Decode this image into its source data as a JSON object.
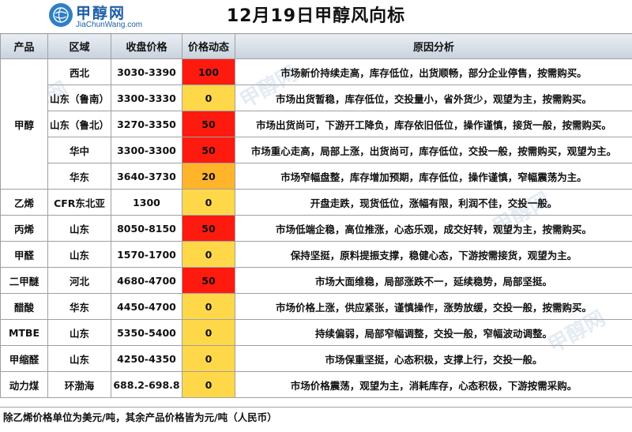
{
  "header": {
    "logo_brand": "甲醇网",
    "logo_url": "JiaChunWang.com",
    "title": "12月19日甲醇风向标"
  },
  "table": {
    "columns": [
      "产品",
      "区域",
      "收盘价格",
      "价格动态",
      "原因分析"
    ],
    "groups": [
      {
        "product": "甲醇",
        "rows": [
          {
            "region": "西北",
            "price": "3030-3390",
            "dynamic": "100",
            "level": "red",
            "reason": "市场新价持续走高，库存低位，出货顺畅，部分企业停售，按需购买。"
          },
          {
            "region": "山东（鲁南）",
            "price": "3300-3330",
            "dynamic": "0",
            "level": "yellow",
            "reason": "市场出货暂稳，库存低位，交投量小，省外货少，观望为主，按需购买。"
          },
          {
            "region": "山东（鲁北）",
            "price": "3270-3350",
            "dynamic": "50",
            "level": "red",
            "reason": "市场出货尚可，下游开工降负，库存依旧低位，操作谨慎，接货一般，按需购买。"
          },
          {
            "region": "华中",
            "price": "3300-3300",
            "dynamic": "50",
            "level": "red",
            "reason": "市场重心走高，局部上涨，出货尚可，库存低位，交投一般，按需购买，观望为主。"
          },
          {
            "region": "华东",
            "price": "3640-3730",
            "dynamic": "20",
            "level": "orange",
            "reason": "市场窄幅盘整，库存增加预期，库存低位，操作谨慎，窄幅震荡为主。"
          }
        ]
      },
      {
        "product": "乙烯",
        "rows": [
          {
            "region": "CFR东北亚",
            "price": "1300",
            "dynamic": "0",
            "level": "yellow",
            "reason": "开盘走跌，现货低位，涨幅有限，利润不佳，交投一般。"
          }
        ]
      },
      {
        "product": "丙烯",
        "rows": [
          {
            "region": "山东",
            "price": "8050-8150",
            "dynamic": "50",
            "level": "red",
            "reason": "市场低端企稳，高位推涨，心态乐观，成交好转，观望为主，按需购买。"
          }
        ]
      },
      {
        "product": "甲醛",
        "rows": [
          {
            "region": "山东",
            "price": "1570-1700",
            "dynamic": "0",
            "level": "yellow",
            "reason": "保持坚挺，原料提振支撑，稳健心态，下游按需接货，观望为主。"
          }
        ]
      },
      {
        "product": "二甲醚",
        "rows": [
          {
            "region": "河北",
            "price": "4680-4700",
            "dynamic": "50",
            "level": "red",
            "reason": "市场大面维稳，局部涨跌不一，延续稳势，局部坚挺。"
          }
        ]
      },
      {
        "product": "醋酸",
        "rows": [
          {
            "region": "华东",
            "price": "4450-4700",
            "dynamic": "0",
            "level": "yellow",
            "reason": "市场价格上涨，供应紧张，谨慎操作，涨势放缓，交投一般，按需购买。"
          }
        ]
      },
      {
        "product": "MTBE",
        "rows": [
          {
            "region": "山东",
            "price": "5350-5400",
            "dynamic": "0",
            "level": "yellow",
            "reason": "持续偏弱，局部窄幅调整，交投一般，窄幅波动调整。"
          }
        ]
      },
      {
        "product": "甲缩醛",
        "rows": [
          {
            "region": "山东",
            "price": "4250-4350",
            "dynamic": "0",
            "level": "yellow",
            "reason": "市场保重坚挺，心态积极，支撑上行，交投一般。"
          }
        ]
      },
      {
        "product": "动力煤",
        "rows": [
          {
            "region": "环渤海",
            "price": "688.2-698.8",
            "dynamic": "0",
            "level": "yellow",
            "reason": "市场价格震荡，观望为主，消耗库存，心态积极，下游按需采购。"
          }
        ]
      }
    ]
  },
  "footnote": "除乙烯价格单位为美元/吨，其余产品价格皆为元/吨（人民币）",
  "colors": {
    "red": "#ff1a10",
    "orange": "#ffb42a",
    "yellow": "#ffd84a",
    "header_bg": "#d6dee7",
    "brand": "#1f5fa8"
  },
  "icons": [
    "globe-logo-icon",
    "watermark-logo-icon"
  ]
}
